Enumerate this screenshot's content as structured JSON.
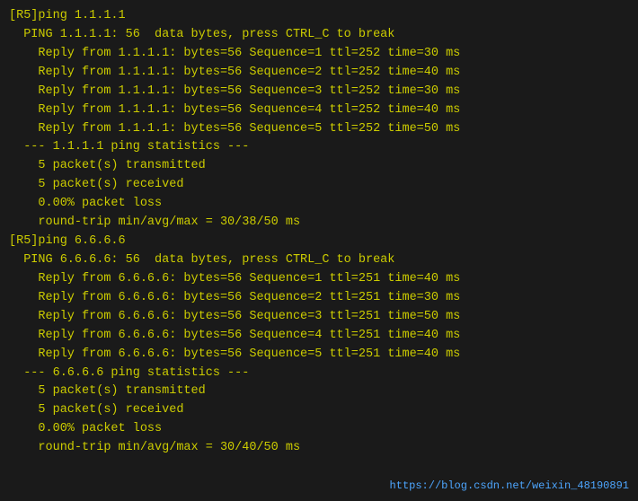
{
  "terminal": {
    "lines": [
      {
        "id": "line1",
        "text": "[R5]ping 1.1.1.1"
      },
      {
        "id": "line2",
        "text": "  PING 1.1.1.1: 56  data bytes, press CTRL_C to break"
      },
      {
        "id": "line3",
        "text": "    Reply from 1.1.1.1: bytes=56 Sequence=1 ttl=252 time=30 ms"
      },
      {
        "id": "line4",
        "text": "    Reply from 1.1.1.1: bytes=56 Sequence=2 ttl=252 time=40 ms"
      },
      {
        "id": "line5",
        "text": "    Reply from 1.1.1.1: bytes=56 Sequence=3 ttl=252 time=30 ms"
      },
      {
        "id": "line6",
        "text": "    Reply from 1.1.1.1: bytes=56 Sequence=4 ttl=252 time=40 ms"
      },
      {
        "id": "line7",
        "text": "    Reply from 1.1.1.1: bytes=56 Sequence=5 ttl=252 time=50 ms"
      },
      {
        "id": "line8",
        "text": ""
      },
      {
        "id": "line9",
        "text": "  --- 1.1.1.1 ping statistics ---"
      },
      {
        "id": "line10",
        "text": "    5 packet(s) transmitted"
      },
      {
        "id": "line11",
        "text": "    5 packet(s) received"
      },
      {
        "id": "line12",
        "text": "    0.00% packet loss"
      },
      {
        "id": "line13",
        "text": "    round-trip min/avg/max = 30/38/50 ms"
      },
      {
        "id": "line14",
        "text": ""
      },
      {
        "id": "line15",
        "text": "[R5]ping 6.6.6.6"
      },
      {
        "id": "line16",
        "text": "  PING 6.6.6.6: 56  data bytes, press CTRL_C to break"
      },
      {
        "id": "line17",
        "text": "    Reply from 6.6.6.6: bytes=56 Sequence=1 ttl=251 time=40 ms"
      },
      {
        "id": "line18",
        "text": "    Reply from 6.6.6.6: bytes=56 Sequence=2 ttl=251 time=30 ms"
      },
      {
        "id": "line19",
        "text": "    Reply from 6.6.6.6: bytes=56 Sequence=3 ttl=251 time=50 ms"
      },
      {
        "id": "line20",
        "text": "    Reply from 6.6.6.6: bytes=56 Sequence=4 ttl=251 time=40 ms"
      },
      {
        "id": "line21",
        "text": "    Reply from 6.6.6.6: bytes=56 Sequence=5 ttl=251 time=40 ms"
      },
      {
        "id": "line22",
        "text": ""
      },
      {
        "id": "line23",
        "text": "  --- 6.6.6.6 ping statistics ---"
      },
      {
        "id": "line24",
        "text": "    5 packet(s) transmitted"
      },
      {
        "id": "line25",
        "text": "    5 packet(s) received"
      },
      {
        "id": "line26",
        "text": "    0.00% packet loss"
      },
      {
        "id": "line27",
        "text": "    round-trip min/avg/max = 30/40/50 ms"
      }
    ],
    "watermark": "https://blog.csdn.net/weixin_48190891"
  }
}
